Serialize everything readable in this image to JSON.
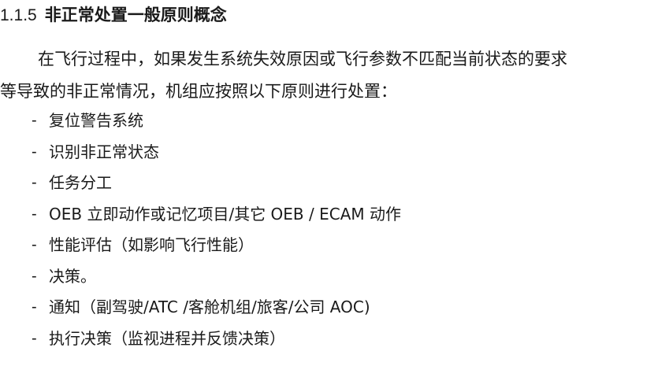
{
  "section": {
    "number": "1.1.5",
    "title": "非正常处置一般原则概念"
  },
  "paragraph": {
    "line1": "在飞行过程中，如果发生系统失效原因或飞行参数不匹配当前状态的要求",
    "line2": "等导致的非正常情况，机组应按照以下原则进行处置："
  },
  "list": {
    "bullet": "-",
    "items": [
      "复位警告系统",
      "识别非正常状态",
      "任务分工",
      "OEB 立即动作或记忆项目/其它 OEB / ECAM  动作",
      "性能评估（如影响飞行性能）",
      "决策。",
      "通知（副驾驶/ATC /客舱机组/旅客/公司 AOC)",
      "执行决策（监视进程并反馈决策）"
    ]
  }
}
